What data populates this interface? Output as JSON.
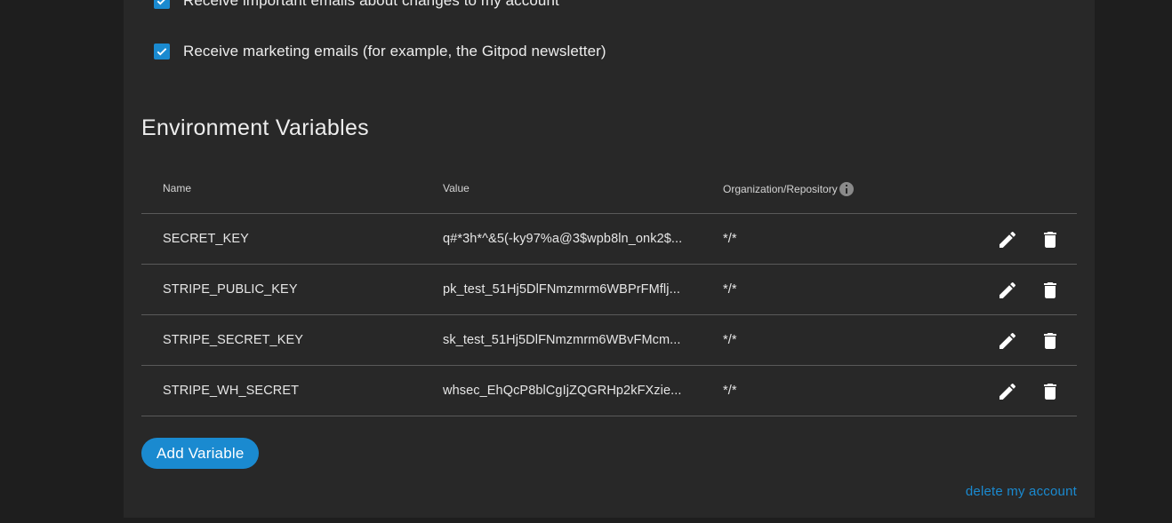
{
  "notifications": {
    "items": [
      {
        "label": "Receive important emails about changes to my account",
        "checked": true
      },
      {
        "label": "Receive marketing emails (for example, the Gitpod newsletter)",
        "checked": true
      }
    ]
  },
  "env": {
    "title": "Environment Variables",
    "headers": {
      "name": "Name",
      "value": "Value",
      "scope": "Organization/Repository"
    },
    "rows": [
      {
        "name": "SECRET_KEY",
        "value": "q#*3h*^&5(-ky97%a@3$wpb8ln_onk2$...",
        "scope": "*/*"
      },
      {
        "name": "STRIPE_PUBLIC_KEY",
        "value": "pk_test_51Hj5DlFNmzmrm6WBPrFMflj...",
        "scope": "*/*"
      },
      {
        "name": "STRIPE_SECRET_KEY",
        "value": "sk_test_51Hj5DlFNmzmrm6WBvFMcm...",
        "scope": "*/*"
      },
      {
        "name": "STRIPE_WH_SECRET",
        "value": "whsec_EhQcP8blCgIjZQGRHp2kFXzie...",
        "scope": "*/*"
      }
    ],
    "add_label": "Add Variable"
  },
  "footer": {
    "delete_account_label": "delete my account"
  },
  "icons": {
    "checkbox": "check-icon",
    "info": "info-icon",
    "edit": "pencil-icon",
    "delete": "trash-icon"
  },
  "colors": {
    "accent": "#1a8ad0",
    "panel": "#282828",
    "background": "#1e1e1e"
  }
}
